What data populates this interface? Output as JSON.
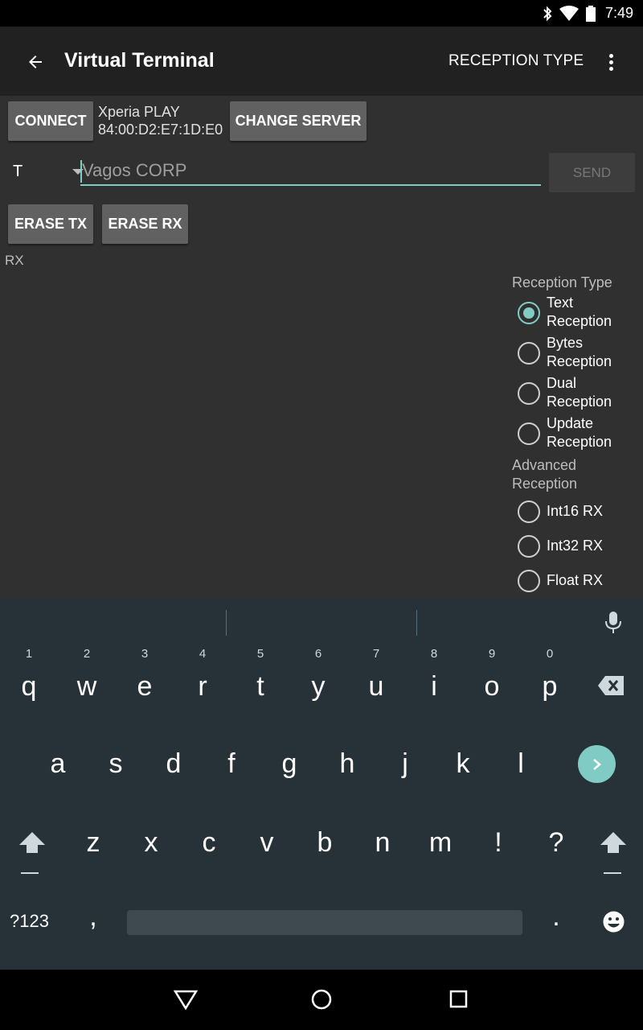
{
  "status_bar": {
    "time": "7:49",
    "icons": [
      "bluetooth-icon",
      "wifi-icon",
      "battery-icon"
    ]
  },
  "app_bar": {
    "title": "Virtual Terminal",
    "action_label": "RECEPTION TYPE",
    "back_icon": "back-arrow-icon",
    "overflow_icon": "overflow-menu-icon"
  },
  "connection": {
    "connect_label": "CONNECT",
    "device_name": "Xperia PLAY",
    "device_address": "84:00:D2:E7:1D:E0",
    "change_server_label": "CHANGE SERVER"
  },
  "tx": {
    "mode_value": "T",
    "input_placeholder": "Vagos CORP",
    "send_label": "SEND"
  },
  "erase": {
    "tx_label": "ERASE TX",
    "rx_label": "ERASE RX"
  },
  "rx": {
    "label": "RX"
  },
  "reception": {
    "group_label": "Reception Type",
    "options": [
      {
        "label_line1": "Text",
        "label_line2": "Reception",
        "checked": true
      },
      {
        "label_line1": "Bytes",
        "label_line2": "Reception",
        "checked": false
      },
      {
        "label_line1": "Dual",
        "label_line2": "Reception",
        "checked": false
      },
      {
        "label_line1": "Update",
        "label_line2": "Reception",
        "checked": false
      }
    ],
    "advanced_label_line1": "Advanced",
    "advanced_label_line2": "Reception",
    "advanced_options": [
      {
        "label": "Int16 RX",
        "checked": false
      },
      {
        "label": "Int32 RX",
        "checked": false
      },
      {
        "label": "Float RX",
        "checked": false
      }
    ]
  },
  "keyboard": {
    "row1": [
      "q",
      "w",
      "e",
      "r",
      "t",
      "y",
      "u",
      "i",
      "o",
      "p"
    ],
    "row1_hints": [
      "1",
      "2",
      "3",
      "4",
      "5",
      "6",
      "7",
      "8",
      "9",
      "0"
    ],
    "row2": [
      "a",
      "s",
      "d",
      "f",
      "g",
      "h",
      "j",
      "k",
      "l"
    ],
    "row3": [
      "z",
      "x",
      "c",
      "v",
      "b",
      "n",
      "m",
      "!",
      "?"
    ],
    "symbols_label": "?123",
    "comma": ",",
    "period": ".",
    "accent_color": "#80cbc4"
  },
  "nav_bar": {
    "icons": [
      "back-triangle-icon",
      "home-circle-icon",
      "recents-square-icon"
    ]
  }
}
